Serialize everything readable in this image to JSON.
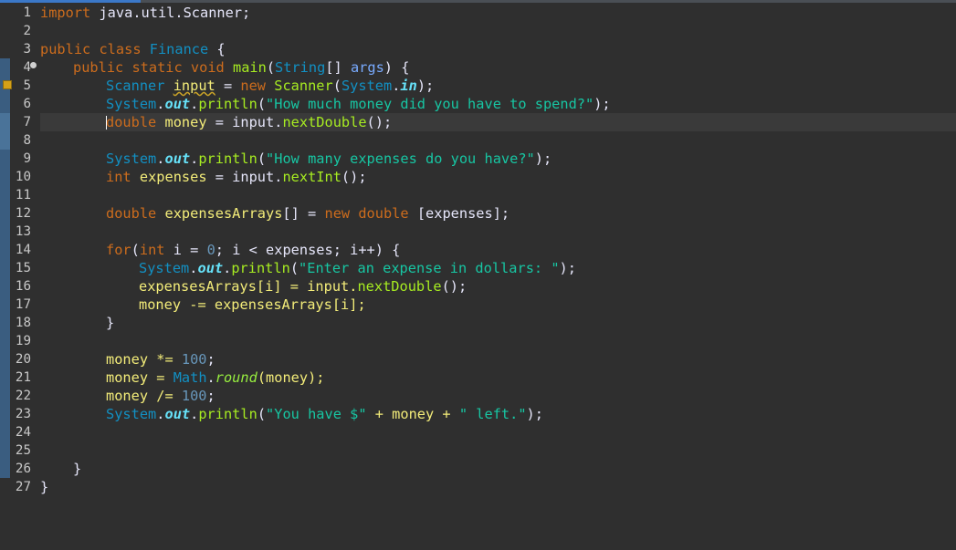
{
  "editor": {
    "line_numbers": [
      "1",
      "2",
      "3",
      "4",
      "5",
      "6",
      "7",
      "8",
      "9",
      "10",
      "11",
      "12",
      "13",
      "14",
      "15",
      "16",
      "17",
      "18",
      "19",
      "20",
      "21",
      "22",
      "23",
      "24",
      "25",
      "26",
      "27"
    ],
    "icons": {
      "fold": "fold-collapse-icon",
      "warning": "warning-icon"
    },
    "lines": {
      "l1": {
        "kw_import": "import",
        "text": " java.util.Scanner;"
      },
      "l3": {
        "kw_public": "public",
        "kw_class": " class ",
        "class_name": "Finance",
        "brace": " {"
      },
      "l4": {
        "kw1": "public static void ",
        "method": "main",
        "p1": "(",
        "type": "String",
        "p2": "[] ",
        "param": "args",
        "p3": ") {"
      },
      "l5": {
        "type": "Scanner",
        "sp": " ",
        "var": "input",
        "eq": " = ",
        "kw_new": "new",
        "sp2": " ",
        "method": "Scanner",
        "p1": "(",
        "cls": "System",
        "dot": ".",
        "field": "in",
        "p2": ");"
      },
      "l6": {
        "cls": "System",
        "dot": ".",
        "field": "out",
        "dot2": ".",
        "method": "println",
        "p1": "(",
        "str": "\"How much money did you have to spend?\"",
        "p2": ");"
      },
      "l7": {
        "kw": "double",
        "sp": " ",
        "var": "money",
        "eq": " = input.",
        "method": "nextDouble",
        "p": "();"
      },
      "l9": {
        "cls": "System",
        "dot": ".",
        "field": "out",
        "dot2": ".",
        "method": "println",
        "p1": "(",
        "str": "\"How many expenses do you have?\"",
        "p2": ");"
      },
      "l10": {
        "kw": "int",
        "sp": " ",
        "var": "expenses",
        "eq": " = input.",
        "method": "nextInt",
        "p": "();"
      },
      "l12": {
        "kw": "double",
        "sp": " ",
        "var": "expensesArrays",
        "mid": "[] = ",
        "kw_new": "new",
        "sp2": " ",
        "kw2": "double",
        "rest": " [expenses];"
      },
      "l14": {
        "kw_for": "for",
        "p1": "(",
        "kw_int": "int",
        "rest1": " i = ",
        "num": "0",
        "rest2": "; i < expenses; i++) {"
      },
      "l15": {
        "cls": "System",
        "dot": ".",
        "field": "out",
        "dot2": ".",
        "method": "println",
        "p1": "(",
        "str": "\"Enter an expense in dollars: \"",
        "p2": ");"
      },
      "l16": {
        "text": "expensesArrays[i] = input.",
        "method": "nextDouble",
        "p": "();"
      },
      "l17": {
        "text": "money -= expensesArrays[i];"
      },
      "l18": {
        "text": "}"
      },
      "l20": {
        "text": "money *= ",
        "num": "100",
        "end": ";"
      },
      "l21": {
        "text": "money = ",
        "cls": "Math",
        "dot": ".",
        "smethod": "round",
        "end": "(money);"
      },
      "l22": {
        "text": "money /= ",
        "num": "100",
        "end": ";"
      },
      "l23": {
        "cls": "System",
        "dot": ".",
        "field": "out",
        "dot2": ".",
        "method": "println",
        "p1": "(",
        "str1": "\"You have $\"",
        "mid": " + money + ",
        "str2": "\" left.\"",
        "p2": ");"
      },
      "l26": {
        "text": "}"
      },
      "l27": {
        "text": "}"
      }
    }
  }
}
